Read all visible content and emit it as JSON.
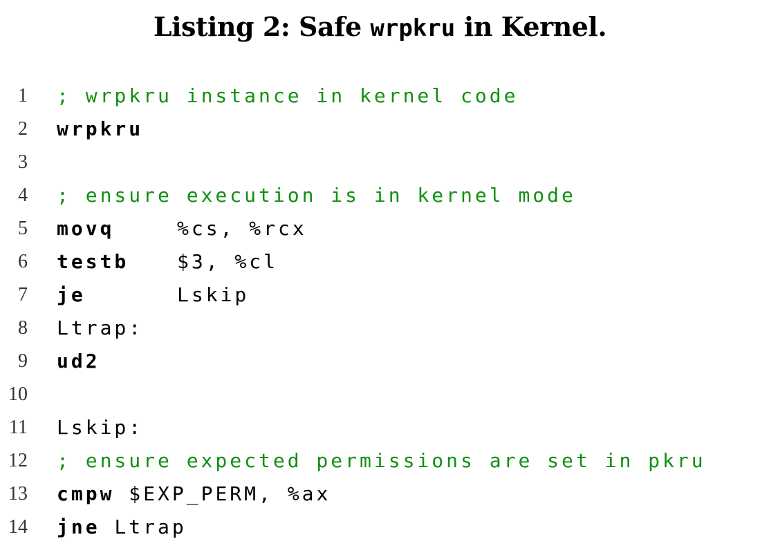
{
  "caption": {
    "prefix": "Listing 2: Safe ",
    "code_word": "wrpkru",
    "suffix": " in Kernel."
  },
  "colors": {
    "comment": "#109010",
    "text": "#000000"
  },
  "listing": {
    "lines": [
      {
        "number": "1",
        "comment": "; wrpkru instance in kernel code"
      },
      {
        "number": "2",
        "instruction": "wrpkru"
      },
      {
        "number": "3"
      },
      {
        "number": "4",
        "comment": "; ensure execution is in kernel mode"
      },
      {
        "number": "5",
        "instruction": "movq",
        "operands": "%cs, %rcx"
      },
      {
        "number": "6",
        "instruction": "testb",
        "operands": "$3, %cl"
      },
      {
        "number": "7",
        "instruction": "je",
        "operands": "Lskip"
      },
      {
        "number": "8",
        "label": "Ltrap:"
      },
      {
        "number": "9",
        "instruction": "ud2"
      },
      {
        "number": "10"
      },
      {
        "number": "11",
        "label": "Lskip:"
      },
      {
        "number": "12",
        "comment": "; ensure expected permissions are set in pkru"
      },
      {
        "number": "13",
        "instruction": "cmpw",
        "operands": "$EXP_PERM, %ax"
      },
      {
        "number": "14",
        "instruction": "jne",
        "operands": "Ltrap"
      }
    ]
  }
}
